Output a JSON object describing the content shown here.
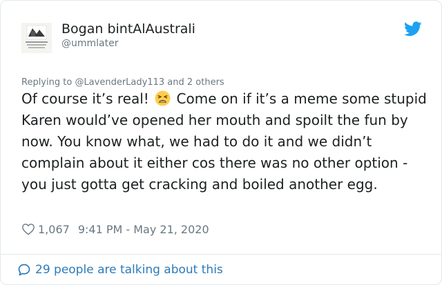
{
  "author": {
    "display_name": "Bogan bintAlAustrali",
    "handle": "@ummlater",
    "avatar_icon": "profile-photo"
  },
  "reply": {
    "prefix": "Replying to",
    "mention": "@LavenderLady113",
    "suffix": "and 2 others"
  },
  "tweet": {
    "text_part1": "Of course it’s real!",
    "emoji_icon": "weary-face-emoji",
    "text_part2": "Come on if it’s a meme some stupid Karen would’ve opened her mouth and spoilt the fun by now. You know what, we had to do it and we didn’t complain about it either cos there was no other option - you just gotta get cracking and boiled another egg."
  },
  "meta": {
    "likes": "1,067",
    "timestamp": "9:41 PM - May 21, 2020"
  },
  "footer": {
    "talking_label": "29 people are talking about this"
  },
  "colors": {
    "twitter_blue": "#1da1f2",
    "link_blue": "#2b7bb9",
    "secondary_text": "#697882",
    "primary_text": "#1c2022",
    "border": "#e1e8ed"
  }
}
